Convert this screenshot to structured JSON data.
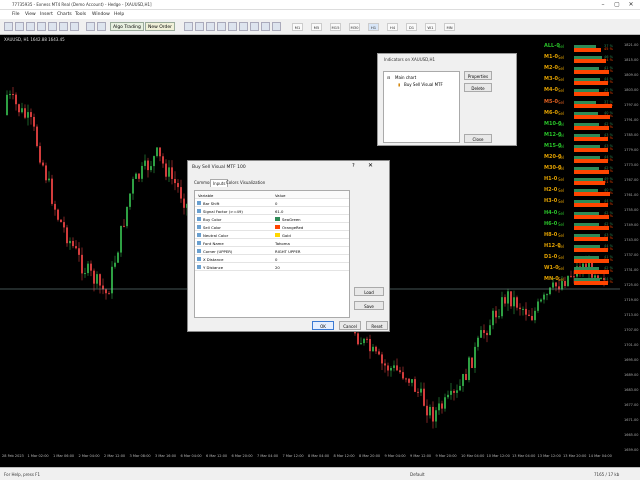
{
  "window": {
    "title": "77735935 - Exness MT4 Real (Demo Account) - Hedge - [XAUUSD,H1]"
  },
  "menu": [
    "File",
    "View",
    "Insert",
    "Charts",
    "Tools",
    "Window",
    "Help"
  ],
  "toolbar": {
    "algo_label": "Algo Trading",
    "neworder_label": "New Order",
    "timeframes": [
      "M1",
      "M5",
      "M15",
      "M30",
      "H1",
      "H4",
      "D1",
      "W1",
      "MN"
    ]
  },
  "chart": {
    "label": "XAUUSD, H1  1642.88 1643.45"
  },
  "dashboard": [
    {
      "name": "ALL-0",
      "sig": "Sel",
      "p1": "37 %",
      "p2": "45 %",
      "c": "#29c029"
    },
    {
      "name": "M1-0",
      "sig": "Sel",
      "p1": "46 %",
      "p2": "54 %",
      "c": "#e0a000"
    },
    {
      "name": "M2-0",
      "sig": "Sel",
      "p1": "41 %",
      "p2": "59 %",
      "c": "#e0a000"
    },
    {
      "name": "M3-0",
      "sig": "Sel",
      "p1": "44 %",
      "p2": "56 %",
      "c": "#e0a000"
    },
    {
      "name": "M4-0",
      "sig": "Sel",
      "p1": "42 %",
      "p2": "58 %",
      "c": "#e0a000"
    },
    {
      "name": "M5-0",
      "sig": "Sel",
      "p1": "37 %",
      "p2": "63 %",
      "c": "#e06020"
    },
    {
      "name": "M6-0",
      "sig": "Sel",
      "p1": "40 %",
      "p2": "60 %",
      "c": "#e0a000"
    },
    {
      "name": "M10-0",
      "sig": "Sel",
      "p1": "42 %",
      "p2": "58 %",
      "c": "#29c029"
    },
    {
      "name": "M12-0",
      "sig": "Sel",
      "p1": "43 %",
      "p2": "57 %",
      "c": "#29c029"
    },
    {
      "name": "M15-0",
      "sig": "Sel",
      "p1": "43 %",
      "p2": "57 %",
      "c": "#29c029"
    },
    {
      "name": "M20-0",
      "sig": "Sel",
      "p1": "44 %",
      "p2": "56 %",
      "c": "#e0a000"
    },
    {
      "name": "M30-0",
      "sig": "Sel",
      "p1": "42 %",
      "p2": "58 %",
      "c": "#e0a000"
    },
    {
      "name": "H1-0",
      "sig": "Sel",
      "p1": "49 %",
      "p2": "51 %",
      "c": "#e0a000"
    },
    {
      "name": "H2-0",
      "sig": "Sel",
      "p1": "40 %",
      "p2": "60 %",
      "c": "#e0a000"
    },
    {
      "name": "H3-0",
      "sig": "Sel",
      "p1": "44 %",
      "p2": "56 %",
      "c": "#e0a000"
    },
    {
      "name": "H4-0",
      "sig": "Sel",
      "p1": "42 %",
      "p2": "58 %",
      "c": "#29c029"
    },
    {
      "name": "H6-0",
      "sig": "Sel",
      "p1": "42 %",
      "p2": "58 %",
      "c": "#29c029"
    },
    {
      "name": "H8-0",
      "sig": "Sel",
      "p1": "43 %",
      "p2": "57 %",
      "c": "#e0a000"
    },
    {
      "name": "H12-0",
      "sig": "Sel",
      "p1": "44 %",
      "p2": "56 %",
      "c": "#e0a000"
    },
    {
      "name": "D1-0",
      "sig": "Sel",
      "p1": "41 %",
      "p2": "59 %",
      "c": "#e0a000"
    },
    {
      "name": "W1-0",
      "sig": "Sel",
      "p1": "42 %",
      "p2": "58 %",
      "c": "#e0a000"
    },
    {
      "name": "MN-0",
      "sig": "Sel",
      "p1": "44 %",
      "p2": "56 %",
      "c": "#e0a000"
    }
  ],
  "yaxis": [
    "1821.00",
    "1815.00",
    "1809.00",
    "1803.00",
    "1797.00",
    "1791.00",
    "1785.00",
    "1779.00",
    "1773.00",
    "1767.00",
    "1761.00",
    "1755.00",
    "1749.00",
    "1743.00",
    "1737.00",
    "1731.00",
    "1725.00",
    "1719.00",
    "1713.00",
    "1707.00",
    "1701.00",
    "1695.00",
    "1689.00",
    "1683.00",
    "1677.00",
    "1671.00",
    "1665.00",
    "1659.00"
  ],
  "xaxis": [
    "28 Feb 2023",
    "1 Mar 02:00",
    "1 Mar 06:00",
    "2 Mar 04:00",
    "2 Mar 12:00",
    "3 Mar 08:00",
    "3 Mar 16:00",
    "6 Mar 04:00",
    "6 Mar 12:00",
    "6 Mar 20:00",
    "7 Mar 04:00",
    "7 Mar 12:00",
    "8 Mar 04:00",
    "8 Mar 12:00",
    "8 Mar 20:00",
    "9 Mar 04:00",
    "9 Mar 12:00",
    "9 Mar 20:00",
    "10 Mar 04:00",
    "10 Mar 12:00",
    "13 Mar 04:00",
    "13 Mar 12:00",
    "13 Mar 20:00",
    "14 Mar 04:00"
  ],
  "navigator": {
    "title": "Indicators on XAUUSD,H1",
    "tree_root": "Main chart",
    "tree_child": "Buy Sell Visual MTF",
    "btn_props": "Properties",
    "btn_delete": "Delete",
    "btn_close": "Close"
  },
  "props": {
    "title": "Buy Sell Visual MTF 100",
    "tabs": [
      "Common",
      "Inputs",
      "Colors",
      "Visualization"
    ],
    "col_variable": "Variable",
    "col_value": "Value",
    "rows": [
      {
        "var": "Bar Shift",
        "val": "0",
        "sw": ""
      },
      {
        "var": "Signal Factor (>=49)",
        "val": "61.0",
        "sw": ""
      },
      {
        "var": "Buy Color",
        "val": "SeaGreen",
        "sw": "#2e8b57"
      },
      {
        "var": "Sell Color",
        "val": "OrangeRed",
        "sw": "#ff4500"
      },
      {
        "var": "Neutral Color",
        "val": "Gold",
        "sw": "#ffd700"
      },
      {
        "var": "Font Name",
        "val": "Tahoma",
        "sw": ""
      },
      {
        "var": "Corner (UPPER)",
        "val": "RIGHT UPPER",
        "sw": ""
      },
      {
        "var": "X Distance",
        "val": "0",
        "sw": ""
      },
      {
        "var": "Y Distance",
        "val": "20",
        "sw": ""
      }
    ],
    "btn_load": "Load",
    "btn_save": "Save",
    "btn_ok": "OK",
    "btn_cancel": "Cancel",
    "btn_reset": "Reset"
  },
  "status": {
    "left": "For Help, press F1",
    "mid": "Default",
    "right": "7165 / 17 kb"
  }
}
